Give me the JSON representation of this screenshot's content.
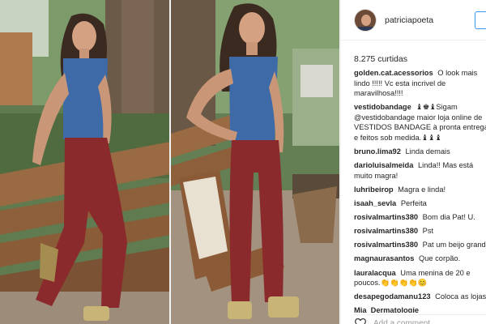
{
  "post": {
    "username": "patriciapoeta",
    "likes": "8.275 curtidas",
    "add_comment_placeholder": "Add a comment...",
    "comments": [
      {
        "user": "golden.cat.acessorios",
        "text": "O look mais lindo !!!!! Vc esta incrivel de maravilhosa!!!!"
      },
      {
        "user": "vestidobandage",
        "text": "♝♚♝Sigam @vestidobandage maior loja online de VESTIDOS BANDAGE à pronta entrega e feitos sob medida.♝♝♝"
      },
      {
        "user": "bruno.lima92",
        "text": "Linda demais"
      },
      {
        "user": "darioluisalmeida",
        "text": "Linda!! Mas está muito magra!"
      },
      {
        "user": "luhribeirop",
        "text": "Magra e linda!"
      },
      {
        "user": "isaah_sevla",
        "text": "Perfeita"
      },
      {
        "user": "rosivalmartins380",
        "text": "Bom dia Pat! U."
      },
      {
        "user": "rosivalmartins380",
        "text": "Pst"
      },
      {
        "user": "rosivalmartins380",
        "text": "Pat um beijo grande"
      },
      {
        "user": "magnaurasantos",
        "text": "Que corpão."
      },
      {
        "user": "lauralacqua",
        "text": "Uma menina de 20 e poucos.👏👏👏👏😊"
      },
      {
        "user": "desapegodamanu123",
        "text": "Coloca as lojas"
      },
      {
        "user": "Mia_Dermatologie",
        "text": ""
      }
    ]
  },
  "colors": {
    "text": "#262626",
    "border": "#efefef",
    "accent": "#3897f0",
    "placeholder": "#999999"
  },
  "icons": {
    "like": "heart-outline-icon",
    "follow": "follow-button-edge"
  },
  "photo": {
    "subject": "woman in denim top and burgundy jeans posing by a wooden railing",
    "panels": 2
  }
}
